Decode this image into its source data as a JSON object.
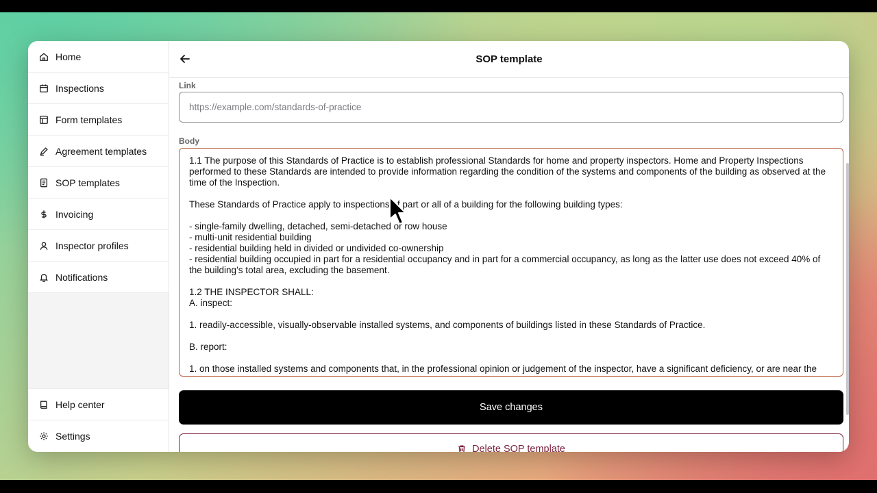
{
  "sidebar": {
    "items": [
      {
        "label": "Home",
        "icon": "home-icon"
      },
      {
        "label": "Inspections",
        "icon": "calendar-icon"
      },
      {
        "label": "Form templates",
        "icon": "layout-icon"
      },
      {
        "label": "Agreement templates",
        "icon": "pen-icon"
      },
      {
        "label": "SOP templates",
        "icon": "document-icon"
      },
      {
        "label": "Invoicing",
        "icon": "dollar-icon"
      },
      {
        "label": "Inspector profiles",
        "icon": "user-icon"
      },
      {
        "label": "Notifications",
        "icon": "bell-icon"
      }
    ],
    "bottom_items": [
      {
        "label": "Help center",
        "icon": "book-icon"
      },
      {
        "label": "Settings",
        "icon": "gear-icon"
      }
    ]
  },
  "header": {
    "title": "SOP template",
    "back_icon": "arrow-left-icon"
  },
  "form": {
    "link_label": "Link",
    "link_placeholder": "https://example.com/standards-of-practice",
    "body_label": "Body",
    "body_text": "1.1 The purpose of this Standards of Practice is to establish professional Standards for home and property inspectors. Home and Property Inspections performed to these Standards are intended to provide information regarding the condition of the systems and components of the building as observed at the time of the Inspection.\n\nThese Standards of Practice apply to inspections of part or all of a building for the following building types:\n\n- single-family dwelling, detached, semi-detached or row house\n- multi-unit residential building\n- residential building held in divided or undivided co-ownership\n- residential building occupied in part for a residential occupancy and in part for a commercial occupancy, as long as the latter use does not exceed 40% of the building’s total area, excluding the basement.\n\n1.2 THE INSPECTOR SHALL:\nA. inspect:\n\n1. readily-accessible, visually-observable installed systems, and components of buildings listed in these Standards of Practice.\n\nB. report:\n\n1. on those installed systems and components that, in the professional opinion or judgement of the inspector, have a significant deficiency, or are near the end of their service lives.",
    "save_label": "Save changes",
    "delete_label": "Delete SOP template",
    "delete_icon": "trash-icon"
  },
  "colors": {
    "accent_border": "#b8623f",
    "danger": "#7a1f3a",
    "primary_button": "#000000"
  }
}
